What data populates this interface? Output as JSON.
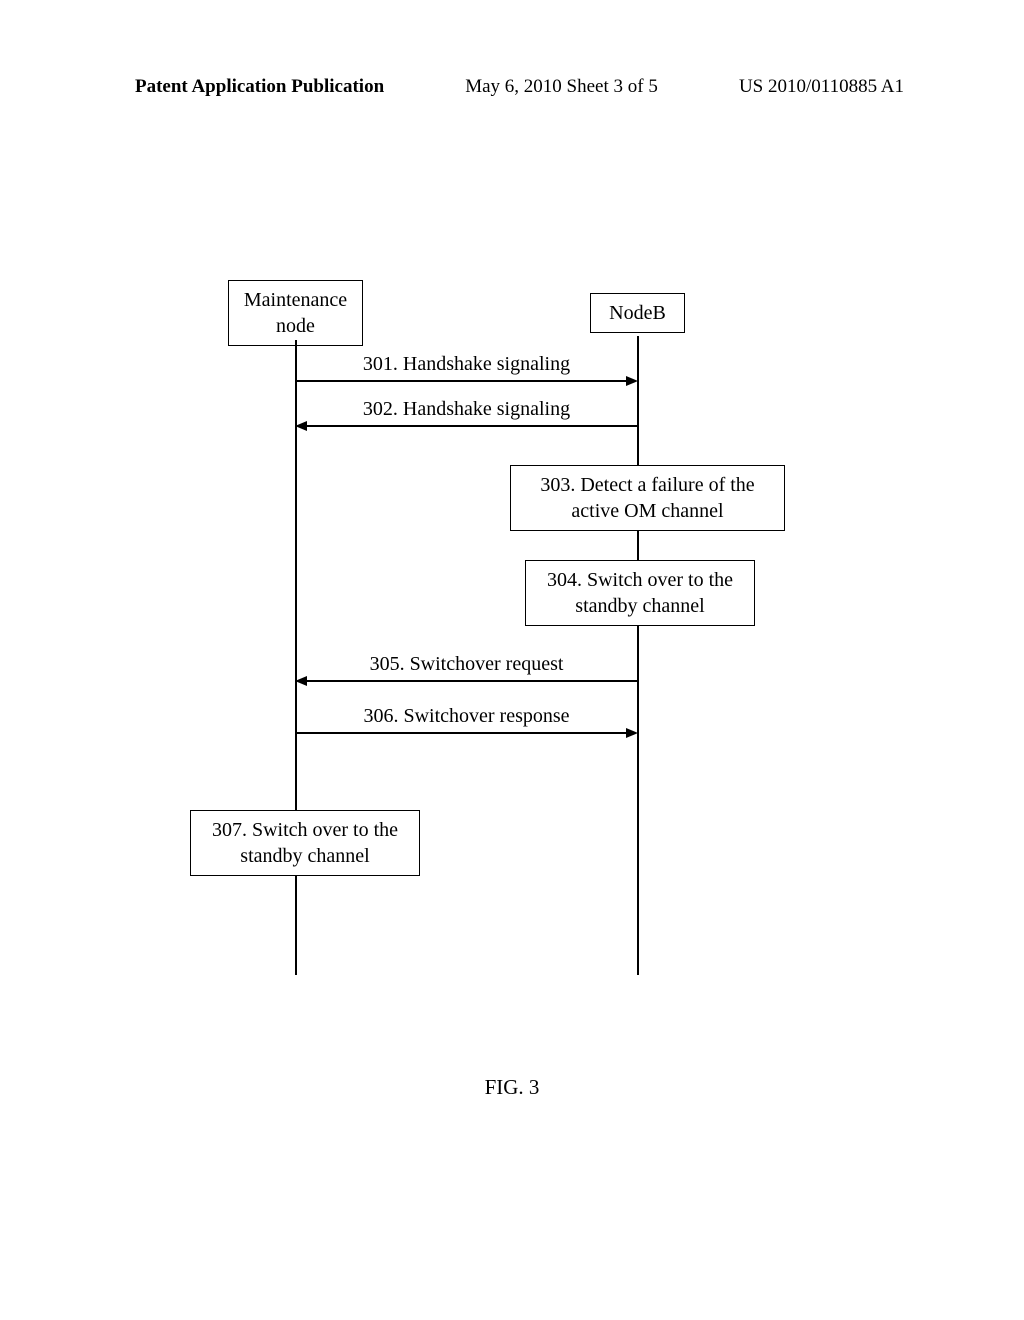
{
  "header": {
    "left": "Patent Application Publication",
    "center": "May 6, 2010  Sheet 3 of 5",
    "right": "US 2010/0110885 A1"
  },
  "actors": {
    "maintenance": "Maintenance\nnode",
    "nodeb": "NodeB"
  },
  "messages": {
    "m301": "301. Handshake signaling",
    "m302": "302. Handshake signaling",
    "m305": "305. Switchover request",
    "m306": "306. Switchover response"
  },
  "steps": {
    "s303": "303. Detect a failure of the\nactive OM channel",
    "s304": "304. Switch over to the\nstandby channel",
    "s307": "307. Switch over to the\nstandby channel"
  },
  "figure_caption": "FIG. 3"
}
